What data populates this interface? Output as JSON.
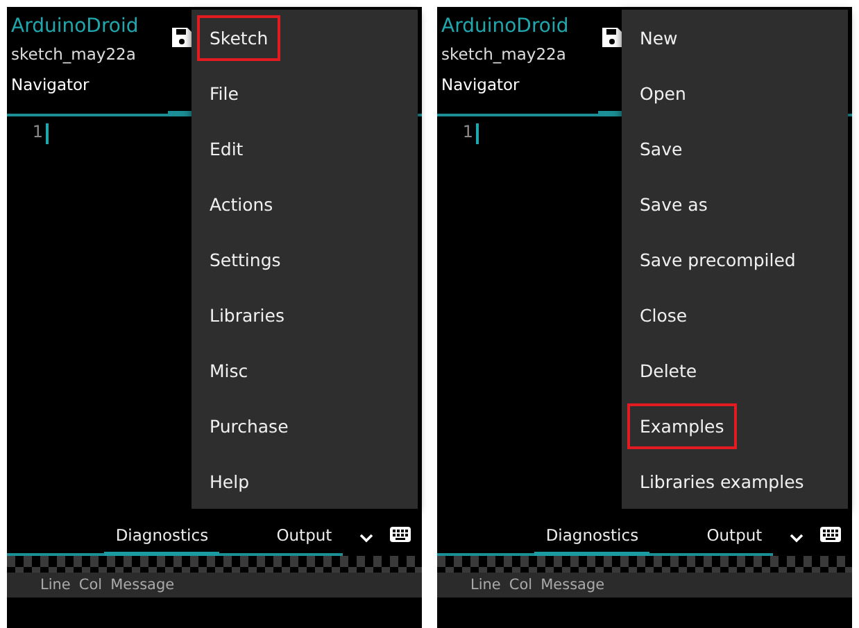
{
  "screens": [
    {
      "app_title": "ArduinoDroid",
      "sketch_name": "sketch_may22a",
      "navigator_label": "Navigator",
      "line_numbers": [
        "1"
      ],
      "menu": [
        {
          "label": "Sketch",
          "highlighted": true
        },
        {
          "label": "File",
          "highlighted": false
        },
        {
          "label": "Edit",
          "highlighted": false
        },
        {
          "label": "Actions",
          "highlighted": false
        },
        {
          "label": "Settings",
          "highlighted": false
        },
        {
          "label": "Libraries",
          "highlighted": false
        },
        {
          "label": "Misc",
          "highlighted": false
        },
        {
          "label": "Purchase",
          "highlighted": false
        },
        {
          "label": "Help",
          "highlighted": false
        }
      ],
      "bottom_tabs": [
        {
          "label": "Diagnostics",
          "selected": true
        },
        {
          "label": "Output",
          "selected": false
        }
      ],
      "message_columns": [
        "Line",
        "Col",
        "Message"
      ]
    },
    {
      "app_title": "ArduinoDroid",
      "sketch_name": "sketch_may22a",
      "navigator_label": "Navigator",
      "line_numbers": [
        "1"
      ],
      "menu": [
        {
          "label": "New",
          "highlighted": false
        },
        {
          "label": "Open",
          "highlighted": false
        },
        {
          "label": "Save",
          "highlighted": false
        },
        {
          "label": "Save as",
          "highlighted": false
        },
        {
          "label": "Save precompiled",
          "highlighted": false
        },
        {
          "label": "Close",
          "highlighted": false
        },
        {
          "label": "Delete",
          "highlighted": false
        },
        {
          "label": "Examples",
          "highlighted": true
        },
        {
          "label": "Libraries examples",
          "highlighted": false
        }
      ],
      "bottom_tabs": [
        {
          "label": "Diagnostics",
          "selected": true
        },
        {
          "label": "Output",
          "selected": false
        }
      ],
      "message_columns": [
        "Line",
        "Col",
        "Message"
      ]
    }
  ]
}
